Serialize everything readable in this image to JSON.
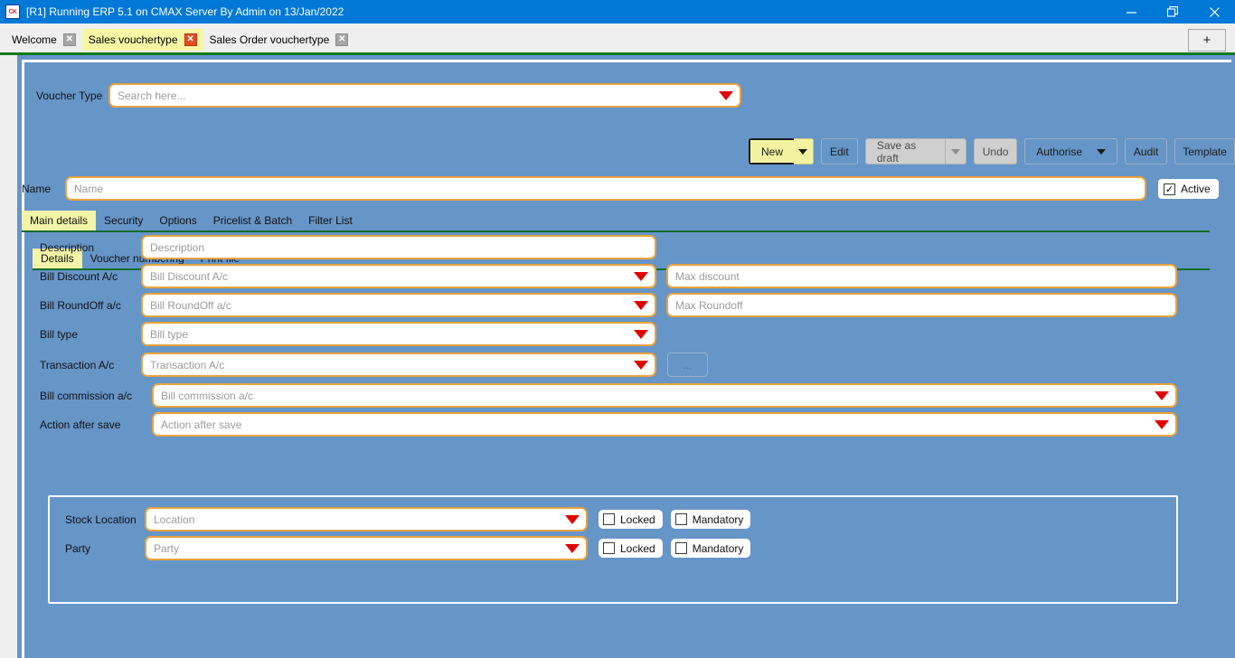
{
  "window": {
    "title": "[R1] Running ERP 5.1 on CMAX Server By Admin on 13/Jan/2022",
    "app_icon": "CK",
    "controls": {
      "minimize": "minimize-icon",
      "restore": "restore-icon",
      "close": "close-icon"
    }
  },
  "tabstrip": {
    "tabs": [
      {
        "label": "Welcome",
        "active": false
      },
      {
        "label": "Sales vouchertype",
        "active": true
      },
      {
        "label": "Sales Order vouchertype",
        "active": false
      }
    ],
    "add_tab_label": "+"
  },
  "header": {
    "voucher_type_label": "Voucher Type",
    "voucher_type_placeholder": "Search here...",
    "name_label": "Name",
    "name_placeholder": "Name",
    "active_label": "Active",
    "active_checked": true
  },
  "toolbar": {
    "new_label": "New",
    "edit_label": "Edit",
    "save_draft_label": "Save as draft",
    "undo_label": "Undo",
    "authorise_label": "Authorise",
    "audit_label": "Audit",
    "template_label": "Template"
  },
  "main_tabs": [
    {
      "label": "Main details",
      "active": true
    },
    {
      "label": "Security",
      "active": false
    },
    {
      "label": "Options",
      "active": false
    },
    {
      "label": "Pricelist & Batch",
      "active": false
    },
    {
      "label": "Filter List",
      "active": false
    }
  ],
  "sub_tabs": [
    {
      "label": "Details",
      "active": true
    },
    {
      "label": "Voucher numbering",
      "active": false
    },
    {
      "label": "Print file",
      "active": false
    }
  ],
  "form": {
    "description": {
      "label": "Description",
      "placeholder": "Description"
    },
    "bill_discount": {
      "label": "Bill Discount A/c",
      "placeholder": "Bill Discount A/c"
    },
    "max_discount": {
      "placeholder": "Max discount"
    },
    "bill_roundoff": {
      "label": "Bill RoundOff a/c",
      "placeholder": "Bill RoundOff a/c"
    },
    "max_roundoff": {
      "placeholder": "Max Roundoff"
    },
    "bill_type": {
      "label": "Bill type",
      "placeholder": "Bill type"
    },
    "transaction_ac": {
      "label": "Transaction A/c",
      "placeholder": "Transaction A/c"
    },
    "browse_label": "...",
    "bill_commission": {
      "label": "Bill commission a/c",
      "placeholder": "Bill commission a/c"
    },
    "action_after_save": {
      "label": "Action after save",
      "placeholder": "Action after save"
    }
  },
  "panel": {
    "stock_location": {
      "label": "Stock Location",
      "placeholder": "Location"
    },
    "party": {
      "label": "Party",
      "placeholder": "Party"
    },
    "locked_label": "Locked",
    "mandatory_label": "Mandatory",
    "checkmark": "✓"
  },
  "colors": {
    "titlebar": "#0078d7",
    "workspace_blue": "#6695c8",
    "field_border": "#e8a33d",
    "caret_red": "#e10000",
    "tab_active_yellow": "#f4f4a8",
    "green_line": "#136b2a"
  }
}
